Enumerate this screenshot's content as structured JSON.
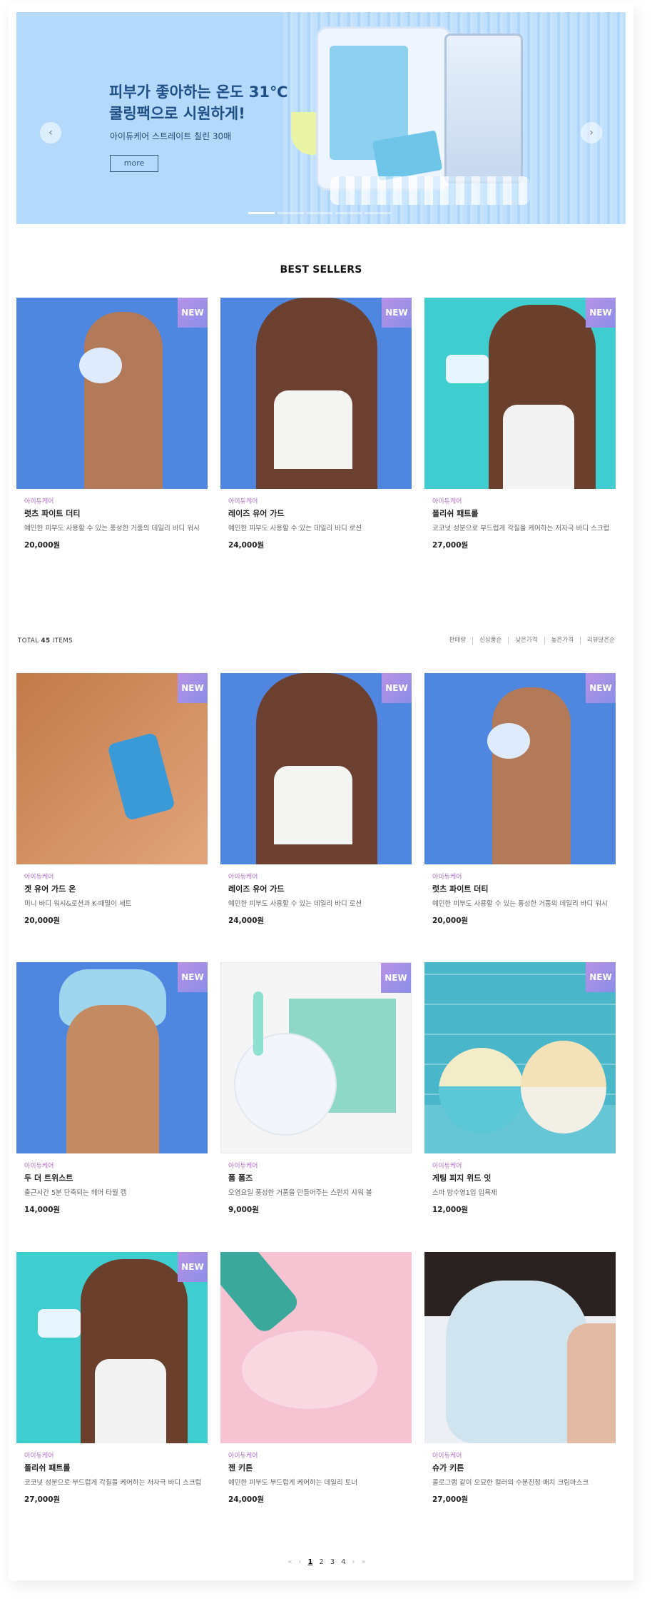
{
  "banner": {
    "headline_line1": "피부가 좋아하는 온도 31℃",
    "headline_line2": "쿨링팩으로 시원하게!",
    "subtitle": "아이듀케어 스트레이트 칠린 30매",
    "more_label": "more",
    "prev_icon": "chevron-left-icon",
    "next_icon": "chevron-right-icon",
    "prev_glyph": "‹",
    "next_glyph": "›",
    "slide_count": 5,
    "active_slide": 1
  },
  "best_sellers": {
    "title": "BEST SELLERS",
    "items": [
      {
        "badge": "NEW",
        "brand": "아이듀케어",
        "name": "럿츠 파이트 더티",
        "desc": "예민한 피부도 사용할 수 있는 풍성한 거품의 데일리 바디 워시",
        "price": "20,000원"
      },
      {
        "badge": "NEW",
        "brand": "아이듀케어",
        "name": "레이즈 유어 가드",
        "desc": "예민한 피부도 사용할 수 있는 데일리 바디 로션",
        "price": "24,000원"
      },
      {
        "badge": "NEW",
        "brand": "아이듀케어",
        "name": "폴리쉬 패트롤",
        "desc": "코코넛 성분으로 부드럽게 각질을 케어하는 저자극 바디 스크럽",
        "price": "27,000원"
      }
    ]
  },
  "toolbar": {
    "total_prefix": "TOTAL",
    "total_count": "45",
    "total_suffix": "ITEMS",
    "sorts": [
      "판매량",
      "신상품순",
      "낮은가격",
      "높은가격",
      "리뷰많은순"
    ]
  },
  "products": [
    {
      "badge": "NEW",
      "brand": "아이듀케어",
      "name": "겟 유어 가드 온",
      "desc": "미니 바디 워시&로션과 K-때밀이 세트",
      "price": "20,000원"
    },
    {
      "badge": "NEW",
      "brand": "아이듀케어",
      "name": "레이즈 유어 가드",
      "desc": "예민한 피부도 사용할 수 있는 데일리 바디 로션",
      "price": "24,000원"
    },
    {
      "badge": "NEW",
      "brand": "아이듀케어",
      "name": "럿츠 파이트 더티",
      "desc": "예민한 피부도 사용할 수 있는 풍성한 거품의 데일리 바디 워시",
      "price": "20,000원"
    },
    {
      "badge": "NEW",
      "brand": "아이듀케어",
      "name": "두 더 트위스트",
      "desc": "출근시간 5분 단축되는 헤어 타월 캡",
      "price": "14,000원"
    },
    {
      "badge": "NEW",
      "brand": "아이듀케어",
      "name": "폼 폼즈",
      "desc": "오염요일 풍성한 거품을 만들어주는 스펀지 샤워 볼",
      "price": "9,000원"
    },
    {
      "badge": "NEW",
      "brand": "아이듀케어",
      "name": "게팅 피지 위드 잇",
      "desc": "스파 밤수영1입 입욕제",
      "price": "12,000원"
    },
    {
      "badge": "NEW",
      "brand": "아이듀케어",
      "name": "폴리쉬 패트롤",
      "desc": "코코넛 성분으로 부드럽게 각질을 케어하는 저자극 바디 스크럽",
      "price": "27,000원"
    },
    {
      "badge": "",
      "brand": "아이듀케어",
      "name": "젠 키튼",
      "desc": "예민한 피부도 부드럽게 케어하는 데일리 토너",
      "price": "24,000원"
    },
    {
      "badge": "",
      "brand": "아이듀케어",
      "name": "슈가 키튼",
      "desc": "콜로그램 같이 오묘한 컬러의 수분진정 패치 크림마스크",
      "price": "27,000원"
    }
  ],
  "pagination": {
    "first": "«",
    "prev": "‹",
    "pages": [
      "1",
      "2",
      "3",
      "4"
    ],
    "current": "1",
    "next": "›",
    "last": "»"
  }
}
